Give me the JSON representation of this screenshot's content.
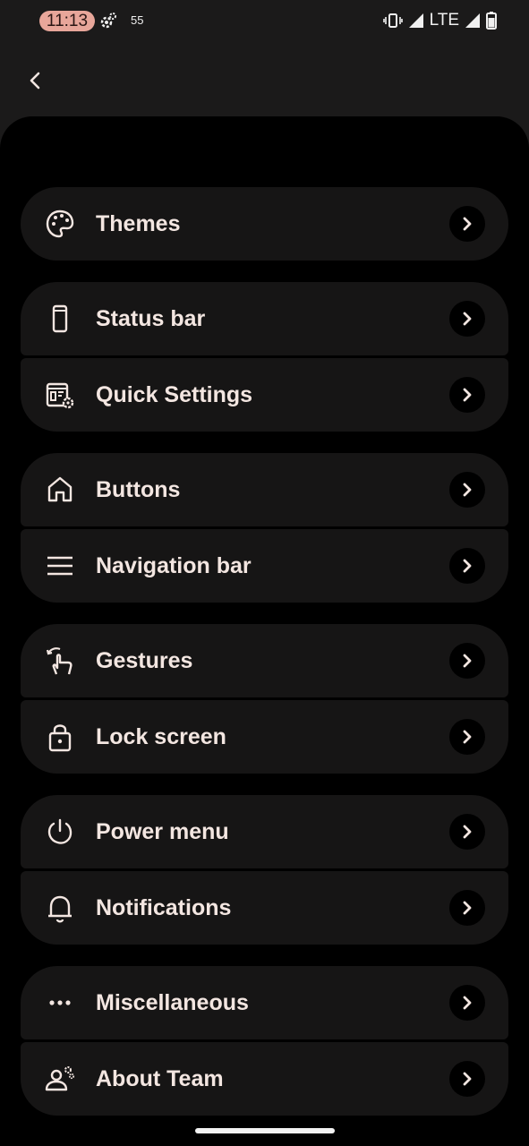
{
  "status_bar": {
    "time": "11:13",
    "notification_count": "55",
    "network": "LTE"
  },
  "menu": {
    "groups": [
      {
        "items": [
          {
            "label": "Themes",
            "icon": "palette-icon"
          }
        ]
      },
      {
        "items": [
          {
            "label": "Status bar",
            "icon": "phone-icon"
          },
          {
            "label": "Quick Settings",
            "icon": "quick-settings-icon"
          }
        ]
      },
      {
        "items": [
          {
            "label": "Buttons",
            "icon": "home-icon"
          },
          {
            "label": "Navigation bar",
            "icon": "menu-lines-icon"
          }
        ]
      },
      {
        "items": [
          {
            "label": "Gestures",
            "icon": "gesture-icon"
          },
          {
            "label": "Lock screen",
            "icon": "lock-icon"
          }
        ]
      },
      {
        "items": [
          {
            "label": "Power menu",
            "icon": "power-icon"
          },
          {
            "label": "Notifications",
            "icon": "bell-icon"
          }
        ]
      },
      {
        "items": [
          {
            "label": "Miscellaneous",
            "icon": "more-dots-icon"
          },
          {
            "label": "About Team",
            "icon": "team-icon"
          }
        ]
      }
    ]
  },
  "colors": {
    "accent": "#e8a69a",
    "card": "#161515",
    "sheet": "#000000",
    "text": "#f3e6e1"
  }
}
